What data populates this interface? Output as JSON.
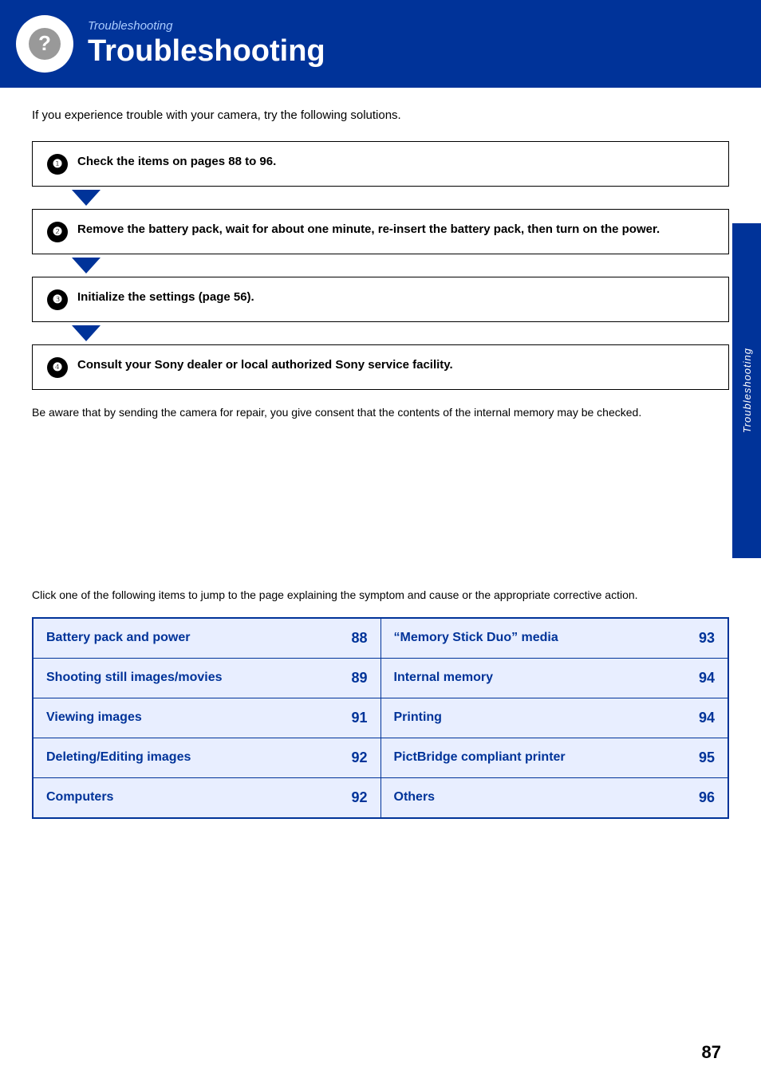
{
  "header": {
    "subtitle": "Troubleshooting",
    "title": "Troubleshooting",
    "icon_label": "question-mark-icon"
  },
  "intro": {
    "text": "If you experience trouble with your camera, try the following solutions."
  },
  "steps": [
    {
      "number": "1",
      "text": "Check the items on pages 88 to 96."
    },
    {
      "number": "2",
      "text": "Remove the battery pack, wait for about one minute, re-insert the battery pack, then turn on the power."
    },
    {
      "number": "3",
      "text": "Initialize the settings (page 56)."
    },
    {
      "number": "4",
      "text": "Consult your Sony dealer or local authorized Sony service facility."
    }
  ],
  "disclaimer": "Be aware that by sending the camera for repair, you give consent that the contents of the internal memory may be checked.",
  "jump_text": "Click one of the following items to jump to the page explaining the symptom and cause or the appropriate corrective action.",
  "topics": [
    {
      "left": {
        "label": "Battery pack and power",
        "page": "88"
      },
      "right": {
        "label": "“Memory Stick Duo” media",
        "page": "93"
      }
    },
    {
      "left": {
        "label": "Shooting still images/movies",
        "page": "89"
      },
      "right": {
        "label": "Internal memory",
        "page": "94"
      }
    },
    {
      "left": {
        "label": "Viewing images",
        "page": "91"
      },
      "right": {
        "label": "Printing",
        "page": "94"
      }
    },
    {
      "left": {
        "label": "Deleting/Editing images",
        "page": "92"
      },
      "right": {
        "label": "PictBridge compliant printer",
        "page": "95"
      }
    },
    {
      "left": {
        "label": "Computers",
        "page": "92"
      },
      "right": {
        "label": "Others",
        "page": "96"
      }
    }
  ],
  "sidebar_label": "Troubleshooting",
  "page_number": "87"
}
